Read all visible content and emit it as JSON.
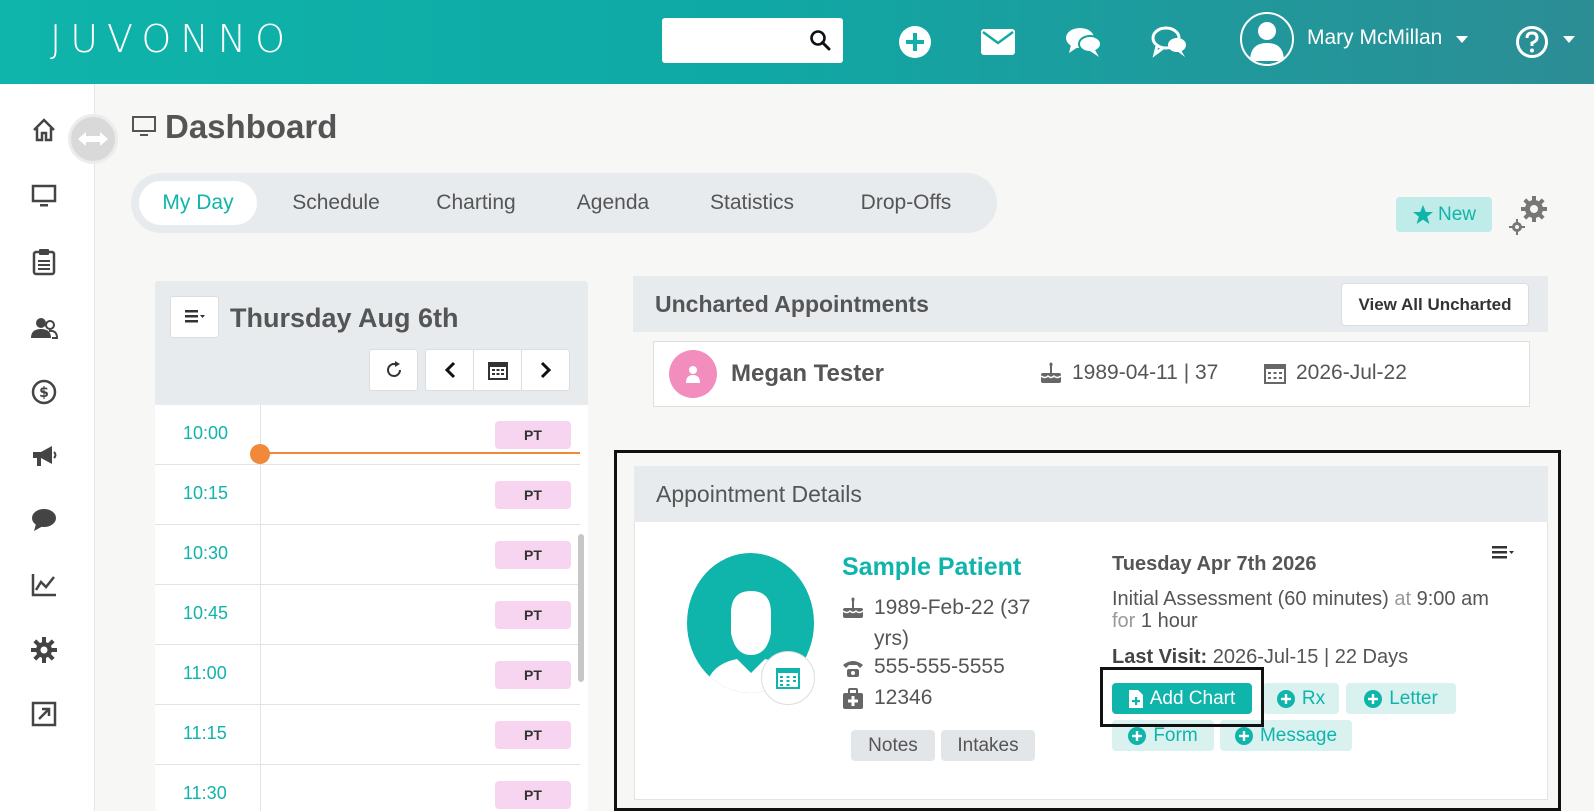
{
  "header": {
    "logo": "JUVONNO",
    "search_placeholder": "",
    "user_name": "Mary McMillan"
  },
  "sidebar": {
    "items": [
      "home-icon",
      "monitor-icon",
      "clipboard-icon",
      "users-icon",
      "dollar-icon",
      "megaphone-icon",
      "chat-icon",
      "chart-icon",
      "gear-icon",
      "external-link-icon"
    ]
  },
  "page": {
    "title": "Dashboard",
    "tabs": [
      {
        "label": "My Day",
        "active": true
      },
      {
        "label": "Schedule"
      },
      {
        "label": "Charting"
      },
      {
        "label": "Agenda"
      },
      {
        "label": "Statistics"
      },
      {
        "label": "Drop-Offs"
      }
    ],
    "new_label": "New"
  },
  "schedule": {
    "date": "Thursday Aug 6th",
    "slots": [
      {
        "time": "10:00",
        "tag": "PT"
      },
      {
        "time": "10:15",
        "tag": "PT"
      },
      {
        "time": "10:30",
        "tag": "PT"
      },
      {
        "time": "10:45",
        "tag": "PT"
      },
      {
        "time": "11:00",
        "tag": "PT"
      },
      {
        "time": "11:15",
        "tag": "PT"
      },
      {
        "time": "11:30",
        "tag": "PT"
      }
    ]
  },
  "uncharted": {
    "title": "Uncharted Appointments",
    "view_all": "View All Uncharted",
    "patient": {
      "name": "Megan Tester",
      "dob": "1989-04-11 | 37",
      "date": "2026-Jul-22"
    }
  },
  "details": {
    "title": "Appointment Details",
    "patient_name": "Sample Patient",
    "dob": "1989-Feb-22 (37 yrs)",
    "phone": "555-555-5555",
    "id": "12346",
    "notes_label": "Notes",
    "intakes_label": "Intakes",
    "appt_date": "Tuesday Apr 7th 2026",
    "service": "Initial Assessment (60 minutes)",
    "at_word": "at",
    "time": "9:00 am",
    "for_word": "for",
    "duration": "1 hour",
    "last_visit_label": "Last Visit:",
    "last_visit_value": "2026-Jul-15 | 22 Days",
    "actions": {
      "add_chart": "Add Chart",
      "rx": "Rx",
      "letter": "Letter",
      "form": "Form",
      "message": "Message"
    }
  },
  "colors": {
    "brand": "#0fb4aa",
    "accent_pink": "#f28dbd",
    "tag_pink": "#f7d4ef",
    "now_line": "#f0893a"
  }
}
